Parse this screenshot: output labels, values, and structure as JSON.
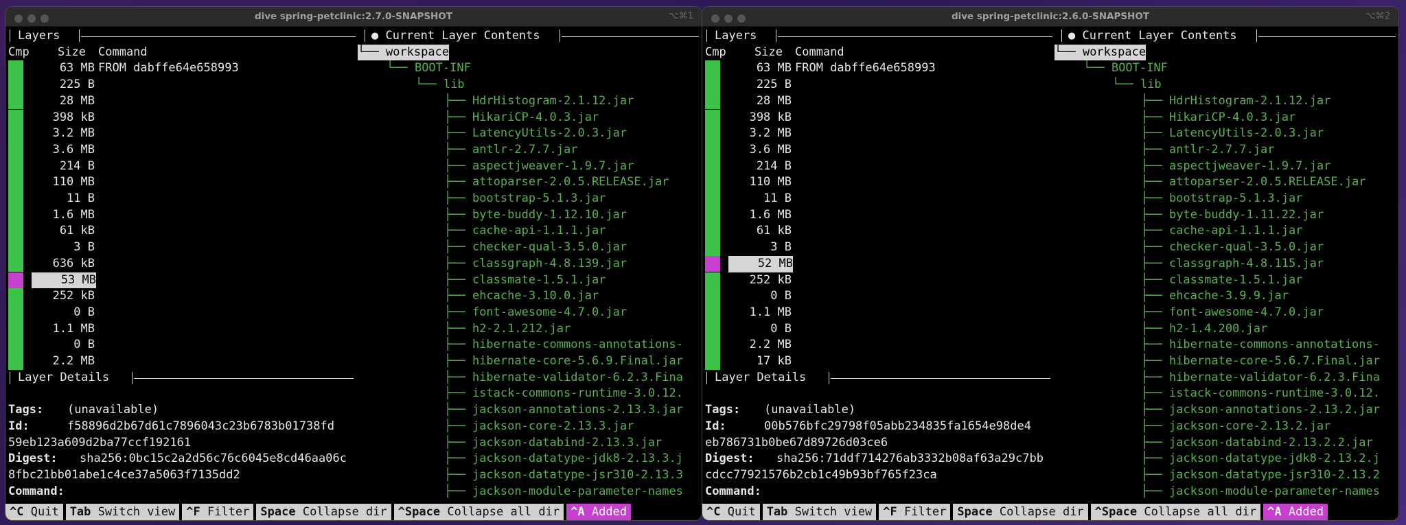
{
  "windows": [
    {
      "title": "dive spring-petclinic:2.7.0-SNAPSHOT",
      "shortcut": "⌥⌘1",
      "layers_title": "Layers",
      "contents_title": "● Current Layer Contents",
      "columns": {
        "cmp": "Cmp",
        "size": "Size",
        "command": "Command"
      },
      "layers": [
        {
          "size": "63 MB",
          "command": "FROM dabffe64e658993"
        },
        {
          "size": "225 B"
        },
        {
          "size": "28 MB"
        },
        {
          "size": "398 kB"
        },
        {
          "size": "3.2 MB"
        },
        {
          "size": "3.6 MB"
        },
        {
          "size": "214 B"
        },
        {
          "size": "110 MB"
        },
        {
          "size": "11 B"
        },
        {
          "size": "1.6 MB"
        },
        {
          "size": "61 kB"
        },
        {
          "size": "3 B"
        },
        {
          "size": "636 kB"
        },
        {
          "size": "53 MB"
        },
        {
          "size": "252 kB"
        },
        {
          "size": "0 B"
        },
        {
          "size": "1.1 MB"
        },
        {
          "size": "0 B"
        },
        {
          "size": "2.2 MB"
        }
      ],
      "selected_index": 13,
      "tree_root": "workspace",
      "tree_l1": "BOOT-INF",
      "tree_l2": "lib",
      "files": [
        "HdrHistogram-2.1.12.jar",
        "HikariCP-4.0.3.jar",
        "LatencyUtils-2.0.3.jar",
        "antlr-2.7.7.jar",
        "aspectjweaver-1.9.7.jar",
        "attoparser-2.0.5.RELEASE.jar",
        "bootstrap-5.1.3.jar",
        "byte-buddy-1.12.10.jar",
        "cache-api-1.1.1.jar",
        "checker-qual-3.5.0.jar",
        "classgraph-4.8.139.jar",
        "classmate-1.5.1.jar",
        "ehcache-3.10.0.jar",
        "font-awesome-4.7.0.jar",
        "h2-2.1.212.jar",
        "hibernate-commons-annotations-",
        "hibernate-core-5.6.9.Final.jar",
        "hibernate-validator-6.2.3.Fina",
        "istack-commons-runtime-3.0.12.",
        "jackson-annotations-2.13.3.jar",
        "jackson-core-2.13.3.jar",
        "jackson-databind-2.13.3.jar",
        "jackson-datatype-jdk8-2.13.3.j",
        "jackson-datatype-jsr310-2.13.3",
        "jackson-module-parameter-names"
      ],
      "details_title": "Layer Details",
      "tags_label": "Tags:",
      "tags_value": "(unavailable)",
      "id_label": "Id:",
      "id_value_1": "f58896d2b67d61c7896043c23b6783b01738fd",
      "id_value_2": "59eb123a609d2ba77ccf192161",
      "digest_label": "Digest:",
      "digest_value_1": "sha256:0bc15c2a2d56c76c6045e8cd46aa06c",
      "digest_value_2": "8fbc21bb01abe1c4ce37a5063f7135dd2",
      "command_label": "Command:"
    },
    {
      "title": "dive spring-petclinic:2.6.0-SNAPSHOT",
      "shortcut": "⌥⌘2",
      "layers_title": "Layers",
      "contents_title": "● Current Layer Contents",
      "columns": {
        "cmp": "Cmp",
        "size": "Size",
        "command": "Command"
      },
      "layers": [
        {
          "size": "63 MB",
          "command": "FROM dabffe64e658993"
        },
        {
          "size": "225 B"
        },
        {
          "size": "28 MB"
        },
        {
          "size": "398 kB"
        },
        {
          "size": "3.2 MB"
        },
        {
          "size": "3.6 MB"
        },
        {
          "size": "214 B"
        },
        {
          "size": "110 MB"
        },
        {
          "size": "11 B"
        },
        {
          "size": "1.6 MB"
        },
        {
          "size": "61 kB"
        },
        {
          "size": "3 B"
        },
        {
          "size": "52 MB"
        },
        {
          "size": "252 kB"
        },
        {
          "size": "0 B"
        },
        {
          "size": "1.1 MB"
        },
        {
          "size": "0 B"
        },
        {
          "size": "2.2 MB"
        },
        {
          "size": "17 kB"
        }
      ],
      "selected_index": 12,
      "tree_root": "workspace",
      "tree_l1": "BOOT-INF",
      "tree_l2": "lib",
      "files": [
        "HdrHistogram-2.1.12.jar",
        "HikariCP-4.0.3.jar",
        "LatencyUtils-2.0.3.jar",
        "antlr-2.7.7.jar",
        "aspectjweaver-1.9.7.jar",
        "attoparser-2.0.5.RELEASE.jar",
        "bootstrap-5.1.3.jar",
        "byte-buddy-1.11.22.jar",
        "cache-api-1.1.1.jar",
        "checker-qual-3.5.0.jar",
        "classgraph-4.8.115.jar",
        "classmate-1.5.1.jar",
        "ehcache-3.9.9.jar",
        "font-awesome-4.7.0.jar",
        "h2-1.4.200.jar",
        "hibernate-commons-annotations-",
        "hibernate-core-5.6.7.Final.jar",
        "hibernate-validator-6.2.3.Fina",
        "istack-commons-runtime-3.0.12.",
        "jackson-annotations-2.13.2.jar",
        "jackson-core-2.13.2.jar",
        "jackson-databind-2.13.2.2.jar",
        "jackson-datatype-jdk8-2.13.2.j",
        "jackson-datatype-jsr310-2.13.2",
        "jackson-module-parameter-names"
      ],
      "details_title": "Layer Details",
      "tags_label": "Tags:",
      "tags_value": "(unavailable)",
      "id_label": "Id:",
      "id_value_1": "00b576bfc29798f05abb234835fa1654e98de4",
      "id_value_2": "eb786731b0be67d89726d03ce6",
      "digest_label": "Digest:",
      "digest_value_1": "sha256:71ddf714276ab3332b08af63a29c7bb",
      "digest_value_2": "cdcc77921576b2cb1c49b93bf765f23ca",
      "command_label": "Command:"
    }
  ],
  "keybar": [
    {
      "key": "^C",
      "label": "Quit"
    },
    {
      "key": "Tab",
      "label": "Switch view"
    },
    {
      "key": "^F",
      "label": "Filter"
    },
    {
      "key": "Space",
      "label": "Collapse dir"
    },
    {
      "key": "^Space",
      "label": "Collapse all dir"
    },
    {
      "key": "^A",
      "label": "Added"
    }
  ],
  "colors": {
    "added_bar": "#3ec34a",
    "current_bar": "#c63fcf",
    "tree_text": "#59b04f"
  }
}
